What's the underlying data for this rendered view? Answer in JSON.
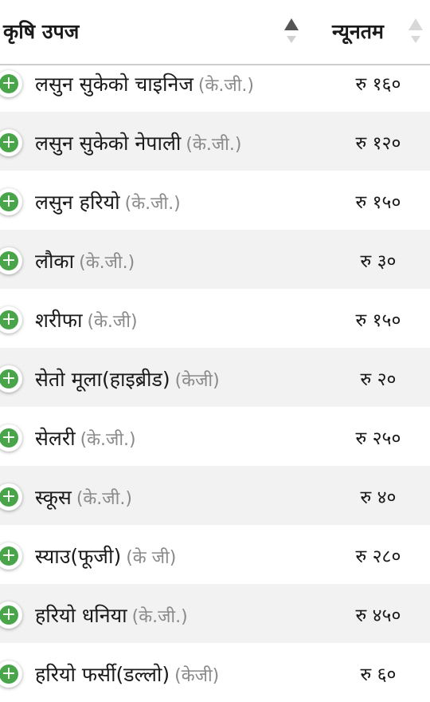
{
  "header": {
    "product_label": "कृषि उपज",
    "min_label": "न्यूनतम"
  },
  "rows": [
    {
      "name": "लसुन सुकेको चाइनिज",
      "unit": "(के.जी.)",
      "price": "रु १६०"
    },
    {
      "name": "लसुन सुकेको नेपाली",
      "unit": "(के.जी.)",
      "price": "रु १२०"
    },
    {
      "name": "लसुन हरियो",
      "unit": "(के.जी.)",
      "price": "रु १५०"
    },
    {
      "name": "लौका",
      "unit": "(के.जी.)",
      "price": "रु ३०"
    },
    {
      "name": "शरीफा",
      "unit": "(के.जी)",
      "price": "रु १५०"
    },
    {
      "name": "सेतो मूला(हाइब्रीड)",
      "unit": "(केजी)",
      "price": "रु २०"
    },
    {
      "name": "सेलरी",
      "unit": "(के.जी.)",
      "price": "रु २५०"
    },
    {
      "name": "स्कूस",
      "unit": "(के.जी.)",
      "price": "रु ४०"
    },
    {
      "name": "स्याउ(फूजी)",
      "unit": "(के जी)",
      "price": "रु २८०"
    },
    {
      "name": "हरियो धनिया",
      "unit": "(के.जी.)",
      "price": "रु ४५०"
    },
    {
      "name": "हरियो फर्सी(डल्लो)",
      "unit": "(केजी)",
      "price": "रु ६०"
    }
  ],
  "add_icon_glyph": "+",
  "colors": {
    "add_green": "#4aa44a",
    "alt_row": "#f2f2f2",
    "unit_gray": "#8a8a8a"
  }
}
